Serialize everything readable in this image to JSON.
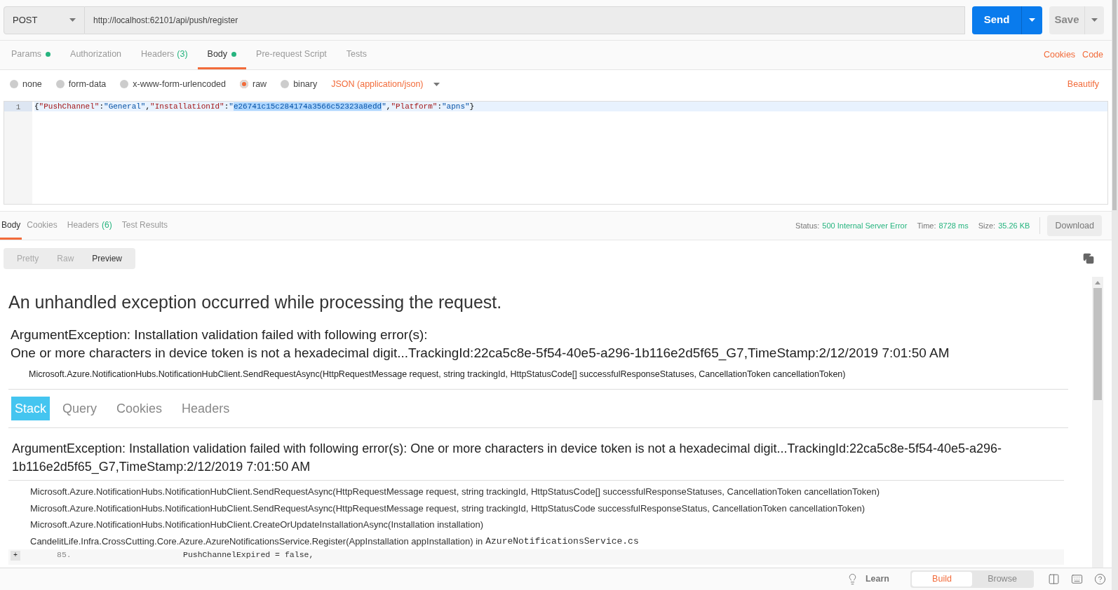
{
  "request": {
    "method": "POST",
    "url": "http://localhost:62101/api/push/register",
    "send": "Send",
    "save": "Save"
  },
  "request_tabs": [
    {
      "label": "Params",
      "dot": true,
      "selected": false
    },
    {
      "label": "Authorization",
      "dot": false,
      "selected": false
    },
    {
      "label": "Headers",
      "count": "(3)",
      "dot": false,
      "selected": false
    },
    {
      "label": "Body",
      "dot": true,
      "selected": true
    },
    {
      "label": "Pre-request Script",
      "dot": false,
      "selected": false
    },
    {
      "label": "Tests",
      "dot": false,
      "selected": false
    }
  ],
  "request_links": [
    "Cookies",
    "Code"
  ],
  "body_modes": [
    {
      "label": "none",
      "selected": false
    },
    {
      "label": "form-data",
      "selected": false
    },
    {
      "label": "x-www-form-urlencoded",
      "selected": false
    },
    {
      "label": "raw",
      "selected": true
    },
    {
      "label": "binary",
      "selected": false
    }
  ],
  "content_type": "JSON (application/json)",
  "beautify": "Beautify",
  "editor": {
    "lines": [
      {
        "number": "1",
        "tokens": [
          {
            "text": "{",
            "kind": "punct",
            "selected": false
          },
          {
            "text": "\"PushChannel\"",
            "kind": "key",
            "selected": false
          },
          {
            "text": ":",
            "kind": "punct",
            "selected": false
          },
          {
            "text": "\"General\"",
            "kind": "string",
            "selected": false
          },
          {
            "text": ",",
            "kind": "punct",
            "selected": false
          },
          {
            "text": "\"InstallationId\"",
            "kind": "key",
            "selected": false
          },
          {
            "text": ":",
            "kind": "punct",
            "selected": false
          },
          {
            "text": "\"",
            "kind": "string",
            "selected": false
          },
          {
            "text": "e26741c15c284174a3566c52323a8edd",
            "kind": "string",
            "selected": true
          },
          {
            "text": "\"",
            "kind": "string",
            "selected": false
          },
          {
            "text": ",",
            "kind": "punct",
            "selected": false
          },
          {
            "text": "\"Platform\"",
            "kind": "key",
            "selected": false
          },
          {
            "text": ":",
            "kind": "punct",
            "selected": false
          },
          {
            "text": "\"apns\"",
            "kind": "string",
            "selected": false
          },
          {
            "text": "}",
            "kind": "punct",
            "selected": false
          }
        ]
      }
    ]
  },
  "response_tabs": [
    {
      "label": "Body",
      "selected": true
    },
    {
      "label": "Cookies",
      "selected": false
    },
    {
      "label": "Headers",
      "count": "(6)",
      "selected": false
    },
    {
      "label": "Test Results",
      "selected": false
    }
  ],
  "status": [
    {
      "label": "Status:",
      "value": "500 Internal Server Error"
    },
    {
      "label": "Time:",
      "value": "8728 ms"
    },
    {
      "label": "Size:",
      "value": "35.26 KB"
    }
  ],
  "download": "Download",
  "view_modes": [
    {
      "label": "Pretty",
      "selected": false
    },
    {
      "label": "Raw",
      "selected": false
    },
    {
      "label": "Preview",
      "selected": true
    }
  ],
  "preview": {
    "heading": "An unhandled exception occurred while processing the request.",
    "exception_lines": [
      "ArgumentException: Installation validation failed with following error(s):",
      "One or more characters in device token is not a hexadecimal digit...TrackingId:22ca5c8e-5f54-40e5-a296-1b116e2d5f65_G7,TimeStamp:2/12/2019 7:01:50 AM"
    ],
    "location": "Microsoft.Azure.NotificationHubs.NotificationHubClient.SendRequestAsync(HttpRequestMessage request, string trackingId, HttpStatusCode[] successfulResponseStatuses, CancellationToken cancellationToken)",
    "tabs": [
      {
        "label": "Stack",
        "selected": true
      },
      {
        "label": "Query",
        "selected": false
      },
      {
        "label": "Cookies",
        "selected": false
      },
      {
        "label": "Headers",
        "selected": false
      }
    ],
    "stack_title": "ArgumentException: Installation validation failed with following error(s): One or more characters in device token is not a hexadecimal digit...TrackingId:22ca5c8e-5f54-40e5-a296-1b116e2d5f65_G7,TimeStamp:2/12/2019 7:01:50 AM",
    "frames": [
      {
        "text": "Microsoft.Azure.NotificationHubs.NotificationHubClient.SendRequestAsync(HttpRequestMessage request, string trackingId, HttpStatusCode[] successfulResponseStatuses, CancellationToken cancellationToken)"
      },
      {
        "text": "Microsoft.Azure.NotificationHubs.NotificationHubClient.SendRequestAsync(HttpRequestMessage request, string trackingId, HttpStatusCode successfulResponseStatus, CancellationToken cancellationToken)"
      },
      {
        "text": "Microsoft.Azure.NotificationHubs.NotificationHubClient.CreateOrUpdateInstallationAsync(Installation installation)"
      },
      {
        "text": "CandelitLife.Infra.CrossCutting.Core.Azure.AzureNotificationsService.Register(AppInstallation appInstallation) in",
        "file": "AzureNotificationsService.cs"
      }
    ],
    "expand": "+",
    "code_lines": [
      {
        "number": "85.",
        "text": "PushChannelExpired = false,"
      }
    ]
  },
  "footer": {
    "learn": "Learn",
    "modes": [
      {
        "label": "Build",
        "selected": true
      },
      {
        "label": "Browse",
        "selected": false
      }
    ]
  }
}
